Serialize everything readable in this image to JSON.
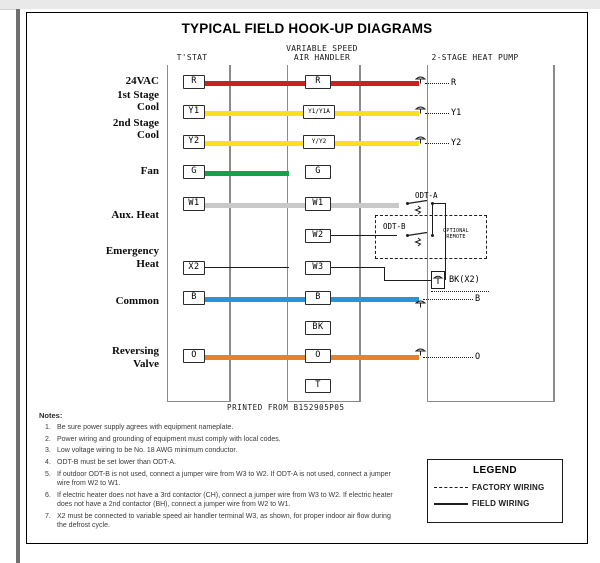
{
  "diagram": {
    "title": "TYPICAL FIELD HOOK-UP DIAGRAMS",
    "printed_from": "PRINTED FROM B152905P05",
    "columns": {
      "tstat": "T'STAT",
      "air_handler_line1": "VARIABLE SPEED",
      "air_handler_line2": "AIR HANDLER",
      "heat_pump": "2-STAGE HEAT PUMP"
    },
    "row_labels": [
      {
        "line1": "24VAC",
        "line2": ""
      },
      {
        "line1": "1st Stage",
        "line2": "Cool"
      },
      {
        "line1": "2nd Stage",
        "line2": "Cool"
      },
      {
        "line1": "Fan",
        "line2": ""
      },
      {
        "line1": "Aux. Heat",
        "line2": ""
      },
      {
        "line1": "Emergency",
        "line2": "Heat"
      },
      {
        "line1": "Common",
        "line2": ""
      },
      {
        "line1": "Reversing",
        "line2": "Valve"
      }
    ],
    "tstat_terminals": [
      {
        "label": "R",
        "color": "#cc2026"
      },
      {
        "label": "Y1",
        "color": "#f7e01d"
      },
      {
        "label": "Y2",
        "color": "#f7e01d"
      },
      {
        "label": "G",
        "color": "#15a04a"
      },
      {
        "label": "W1",
        "color": "#c8c8c8"
      },
      {
        "label": "X2",
        "color": "#4a4a4a"
      },
      {
        "label": "B",
        "color": "#2b93d8"
      },
      {
        "label": "O",
        "color": "#e8822a"
      }
    ],
    "air_handler_terminals": [
      {
        "label": "R"
      },
      {
        "label": "Y1/Y1A"
      },
      {
        "label": "Y/Y2"
      },
      {
        "label": "G"
      },
      {
        "label": "W1"
      },
      {
        "label": "W2"
      },
      {
        "label": "W3"
      },
      {
        "label": "B"
      },
      {
        "label": "BK"
      },
      {
        "label": "O"
      },
      {
        "label": "T"
      }
    ],
    "heat_pump_terminals": [
      {
        "label": "R"
      },
      {
        "label": "Y1"
      },
      {
        "label": "Y2"
      },
      {
        "label": "BK(X2)"
      },
      {
        "label": "B"
      },
      {
        "label": "O"
      }
    ],
    "odt": {
      "a": "ODT-A",
      "b": "ODT-B",
      "optional_line1": "OPTIONAL",
      "optional_line2": "REMOTE"
    }
  },
  "notes": {
    "heading": "Notes:",
    "items": [
      {
        "num": "1.",
        "text": "Be sure power supply agrees with equipment nameplate."
      },
      {
        "num": "2.",
        "text": "Power wiring and grounding of equipment must comply with local codes."
      },
      {
        "num": "3.",
        "text": "Low voltage wiring to be No. 18 AWG minimum conductor."
      },
      {
        "num": "4.",
        "text": "ODT-B must be set lower than ODT-A."
      },
      {
        "num": "5.",
        "text": "If outdoor ODT-B is not used, connect a jumper wire from W3 to W2. If ODT-A is not used, connect a jumper wire from W2 to W1."
      },
      {
        "num": "6.",
        "text": "If electric heater does not have a 3rd contactor (CH), connect a jumper wire from W3 to W2. If electric heater does not have a 2nd contactor (BH), connect a jumper wire from W2 to W1."
      },
      {
        "num": "7.",
        "text": "X2 must be connected to variable speed air handler terminal W3, as shown, for proper indoor air flow during the defrost cycle."
      }
    ]
  },
  "legend": {
    "title": "LEGEND",
    "factory": "FACTORY WIRING",
    "field": "FIELD WIRING"
  }
}
